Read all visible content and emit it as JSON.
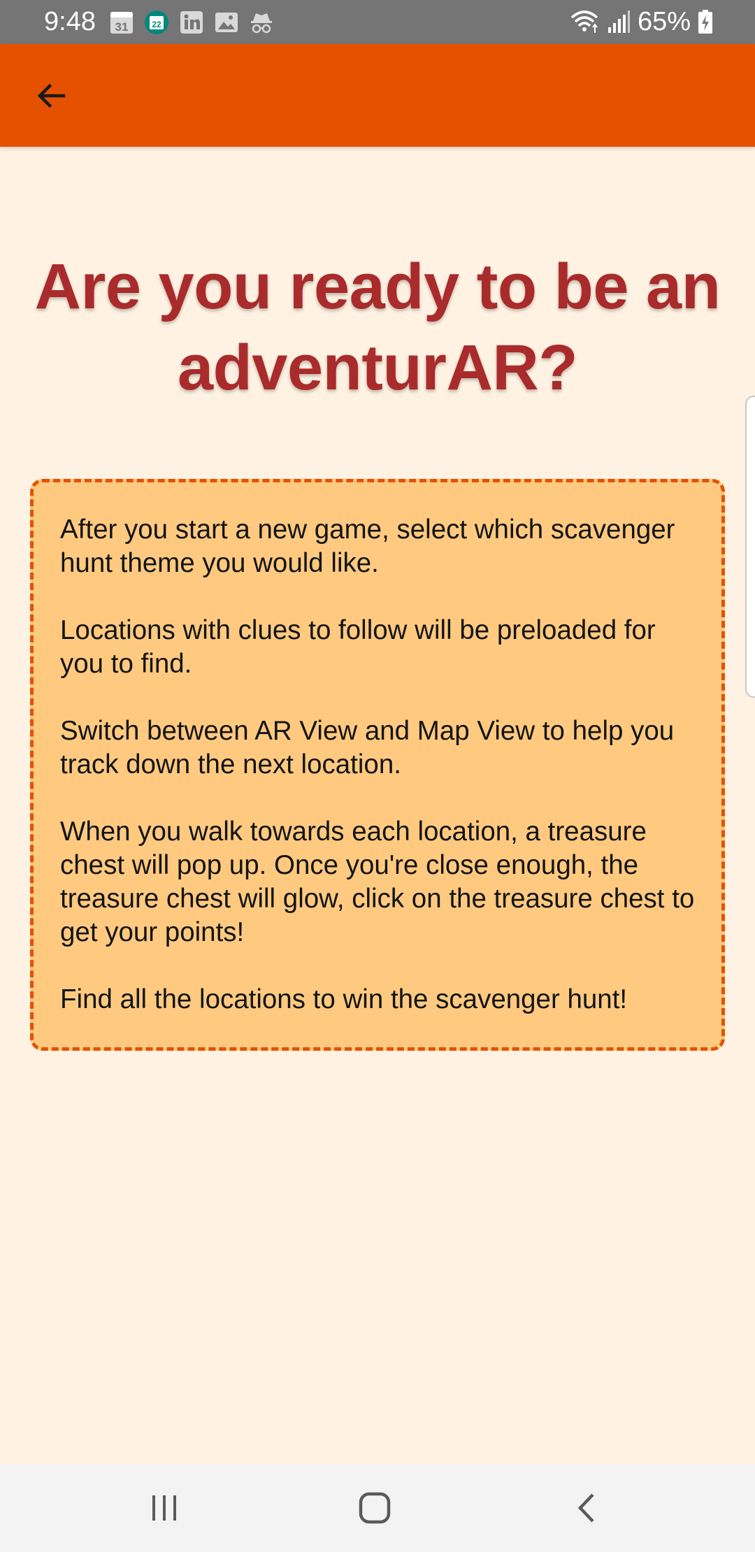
{
  "status_bar": {
    "time": "9:48",
    "notification_icons": [
      "calendar-31-icon",
      "calendar-22-icon",
      "linkedin-icon",
      "gallery-icon",
      "incognito-icon"
    ],
    "calendar_day_a": "31",
    "calendar_day_b": "22",
    "battery_percent": "65%"
  },
  "app_bar": {
    "color": "#E65100",
    "back_icon": "arrow-left-icon"
  },
  "main": {
    "headline": "Are you ready to be an adventurAR?",
    "headline_color": "#A92B2B",
    "instructions": [
      "After you start a new game, select which scavenger hunt theme you would like.",
      "Locations with clues to follow will be preloaded for you to find.",
      "Switch between AR View and Map View to help you track down the next location.",
      "When you walk towards each location, a treasure chest will pop up. Once you're close enough, the treasure chest will glow, click on the treasure chest to get your points!",
      "Find all the locations to win the scavenger hunt!"
    ],
    "card_background": "#FFCA80",
    "card_border_color": "#E65100",
    "page_background": "#FFF2E2"
  },
  "nav_bar": {
    "recents_icon": "recents-icon",
    "home_icon": "home-icon",
    "back_icon": "back-chevron-icon"
  }
}
